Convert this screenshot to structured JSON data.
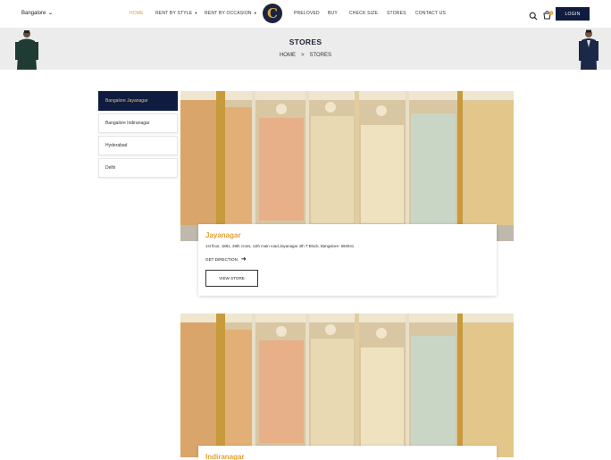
{
  "nav": {
    "city": "Bangalore",
    "menu": [
      {
        "label": "HOME",
        "caret": ""
      },
      {
        "label": "RENT BY STYLE",
        "caret": "▼"
      },
      {
        "label": "RENT BY OCCASION",
        "caret": "▼"
      },
      {
        "label": "PRELOVED",
        "caret": ""
      },
      {
        "label": "BUY",
        "caret": ""
      },
      {
        "label": "CHECK SIZE",
        "caret": ""
      },
      {
        "label": "STORES",
        "caret": ""
      },
      {
        "label": "CONTACT US",
        "caret": ""
      }
    ],
    "logo": "C",
    "cart_count": "0",
    "login": "LOGIN"
  },
  "banner": {
    "title": "STORES",
    "breadcrumb": {
      "home": "HOME",
      "separator": ">",
      "current": "STORES"
    }
  },
  "sidebar": {
    "items": [
      {
        "label": "Bangalore Jayanagar",
        "active": true
      },
      {
        "label": "Bangalore Indiranagar",
        "active": false
      },
      {
        "label": "Hyderabad",
        "active": false
      },
      {
        "label": "Delhi",
        "active": false
      }
    ]
  },
  "stores": [
    {
      "name": "Jayanagar",
      "address": "1st floor, 1881, 39th cross, 11th main road,Jayanagar 4th T Block, Bangalore- 560041",
      "direction_label": "GET DIRECTION",
      "view_label": "VIEW STORE"
    },
    {
      "name": "Indiranagar"
    }
  ],
  "colors": {
    "accent": "#e0a13a",
    "navy": "#0f1c3f"
  }
}
